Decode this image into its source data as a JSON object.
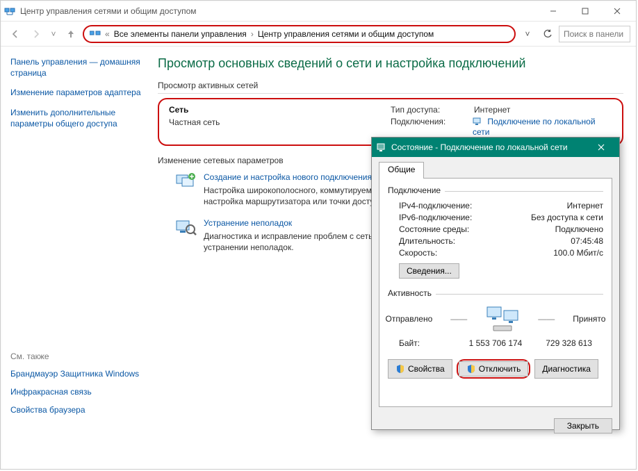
{
  "window": {
    "title": "Центр управления сетями и общим доступом",
    "controls": {
      "min": "—",
      "max": "☐",
      "close": "✕"
    }
  },
  "addressbar": {
    "history_dd": "˅",
    "chev_left": "«",
    "crumb1": "Все элементы панели управления",
    "crumb2": "Центр управления сетями и общим доступом",
    "sep": "›",
    "dropdown": "˅",
    "search_placeholder": "Поиск в панели управ..."
  },
  "sidebar": {
    "link1": "Панель управления — домашняя страница",
    "link2": "Изменение параметров адаптера",
    "link3": "Изменить дополнительные параметры общего доступа",
    "see_also": "См. также",
    "bottom1": "Брандмауэр Защитника Windows",
    "bottom2": "Инфракрасная связь",
    "bottom3": "Свойства браузера"
  },
  "main": {
    "heading": "Просмотр основных сведений о сети и настройка подключений",
    "active_head": "Просмотр активных сетей",
    "net": {
      "name": "Сеть",
      "type": "Частная сеть",
      "access_lbl": "Тип доступа:",
      "access_val": "Интернет",
      "conn_lbl": "Подключения:",
      "conn_val": "Подключение по локальной сети"
    },
    "change_head": "Изменение сетевых параметров",
    "a1_title": "Создание и настройка нового подключения или сети",
    "a1_desc": "Настройка широкополосного, коммутируемого или VPN-подключения либо настройка маршрутизатора или точки доступа.",
    "a2_title": "Устранение неполадок",
    "a2_desc": "Диагностика и исправление проблем с сетью или получение сведений об устранении неполадок."
  },
  "dialog": {
    "title": "Состояние - Подключение по локальной сети",
    "tab": "Общие",
    "sec1": "Подключение",
    "ipv4_lbl": "IPv4-подключение:",
    "ipv4_val": "Интернет",
    "ipv6_lbl": "IPv6-подключение:",
    "ipv6_val": "Без доступа к сети",
    "media_lbl": "Состояние среды:",
    "media_val": "Подключено",
    "dur_lbl": "Длительность:",
    "dur_val": "07:45:48",
    "speed_lbl": "Скорость:",
    "speed_val": "100.0 Мбит/с",
    "details_btn": "Сведения...",
    "sec2": "Активность",
    "sent_lbl": "Отправлено",
    "recv_lbl": "Принято",
    "bytes_lbl": "Байт:",
    "bytes_sent": "1 553 706 174",
    "bytes_recv": "729 328 613",
    "props_btn": "Свойства",
    "disable_btn": "Отключить",
    "diag_btn": "Диагностика",
    "close_btn": "Закрыть"
  }
}
